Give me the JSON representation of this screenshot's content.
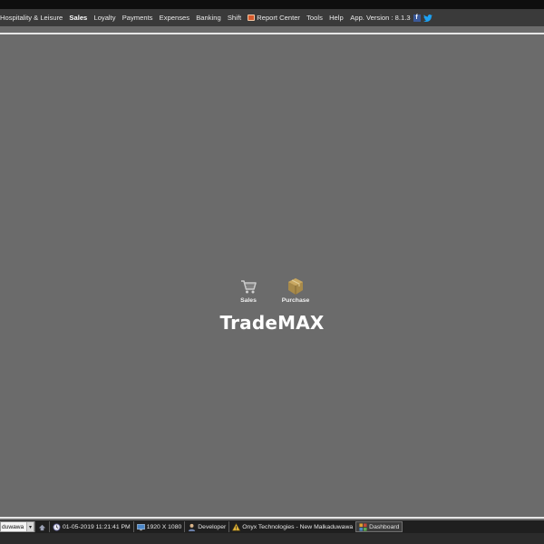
{
  "menu": {
    "items": [
      {
        "label": "Hospitality & Leisure",
        "active": false
      },
      {
        "label": "Sales",
        "active": true
      },
      {
        "label": "Loyalty",
        "active": false
      },
      {
        "label": "Payments",
        "active": false
      },
      {
        "label": "Expenses",
        "active": false
      },
      {
        "label": "Banking",
        "active": false
      },
      {
        "label": "Shift",
        "active": false
      }
    ],
    "report_center": "Report Center",
    "tools": "Tools",
    "help": "Help",
    "version": "App. Version : 8.1.3"
  },
  "modules": [
    {
      "label": "Sales",
      "icon": "cart-icon"
    },
    {
      "label": "Purchase",
      "icon": "package-icon"
    }
  ],
  "app_name": "TradeMAX",
  "status": {
    "location_value": "duwawa",
    "datetime": "01-05-2019 11:21:41 PM",
    "resolution": "1920 X 1080",
    "user": "Developer",
    "company": "Onyx Technologies - New Malkaduwawa",
    "dashboard": "Dashboard"
  },
  "colors": {
    "background": "#6b6b6b",
    "menubar": "#3a3a3a",
    "statusbar": "#1f1f1f"
  }
}
